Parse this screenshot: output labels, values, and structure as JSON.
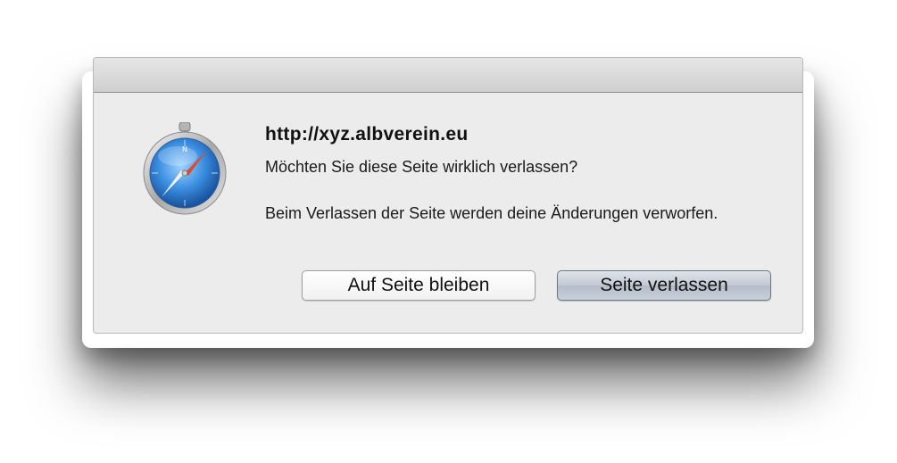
{
  "dialog": {
    "app_icon": "safari-compass-icon",
    "site_url": "http://xyz.albverein.eu",
    "question": "Möchten Sie diese Seite wirklich verlassen?",
    "info": "Beim Verlassen der Seite werden deine Änderungen verworfen."
  },
  "buttons": {
    "stay_label": "Auf Seite bleiben",
    "leave_label": "Seite verlassen"
  },
  "colors": {
    "dialog_background": "#ececec",
    "default_button": "#c2c9d4",
    "compass_blue": "#2f7fd0",
    "compass_red": "#e04a2a"
  }
}
